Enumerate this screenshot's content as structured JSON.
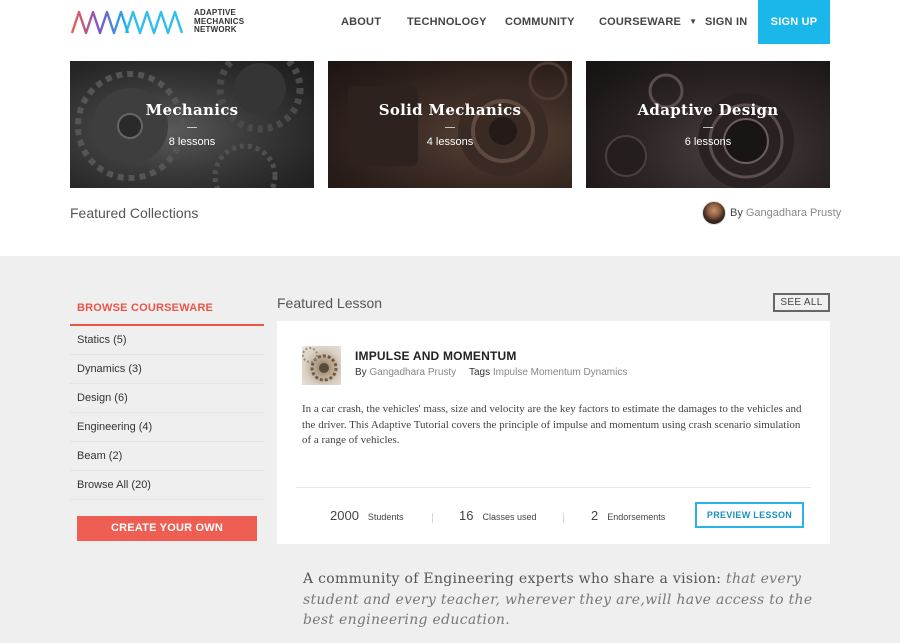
{
  "brand": {
    "line1": "ADAPTIVE",
    "line2": "MECHANICS",
    "line3": "NETWORK",
    "colors": [
      "#ee5e52",
      "#7b57c9",
      "#1ab7ea"
    ]
  },
  "nav": {
    "about": "ABOUT",
    "technology": "TECHNOLOGY",
    "community": "COMMUNITY",
    "courseware": "COURSEWARE",
    "courseware_caret": "▼",
    "sign_in": "SIGN IN",
    "sign_up": "SIGN UP"
  },
  "collections": [
    {
      "title": "Mechanics",
      "count": "8 lessons"
    },
    {
      "title": "Solid Mechanics",
      "count": "4 lessons"
    },
    {
      "title": "Adaptive Design",
      "count": "6 lessons"
    }
  ],
  "featured_collections": {
    "heading": "Featured Collections",
    "by_label": "By",
    "author": "Gangadhara Prusty"
  },
  "sidebar": {
    "title": "BROWSE COURSEWARE",
    "items": [
      "Statics (5)",
      "Dynamics (3)",
      "Design (6)",
      "Engineering (4)",
      "Beam (2)",
      "Browse All (20)"
    ],
    "create_button": "CREATE YOUR OWN"
  },
  "featured_lesson": {
    "heading": "Featured Lesson",
    "see_all": "SEE ALL",
    "title": "IMPULSE AND MOMENTUM",
    "by_label": "By",
    "author": "Gangadhara Prusty",
    "tags_label": "Tags",
    "tags": "Impulse Momentum Dynamics",
    "description": "In a car crash, the vehicles' mass, size and velocity are the key factors to estimate the damages to the vehicles and the driver. This Adaptive Tutorial covers the principle of impulse and momentum using crash scenario simulation of a range of vehicles.",
    "stats": [
      {
        "value": "2000",
        "label": "Students"
      },
      {
        "value": "16",
        "label": "Classes used"
      },
      {
        "value": "2",
        "label": "Endorsements"
      }
    ],
    "preview_button": "PREVIEW LESSON"
  },
  "mission": {
    "plain": "A community of Engineering experts who share a vision:",
    "emphasis": "that every student and every teacher, wherever they are,will have access to the best engineering education."
  },
  "colors": {
    "accent_blue": "#1ab7ea",
    "accent_red": "#ee5e52",
    "gray_bg": "#efefef"
  }
}
